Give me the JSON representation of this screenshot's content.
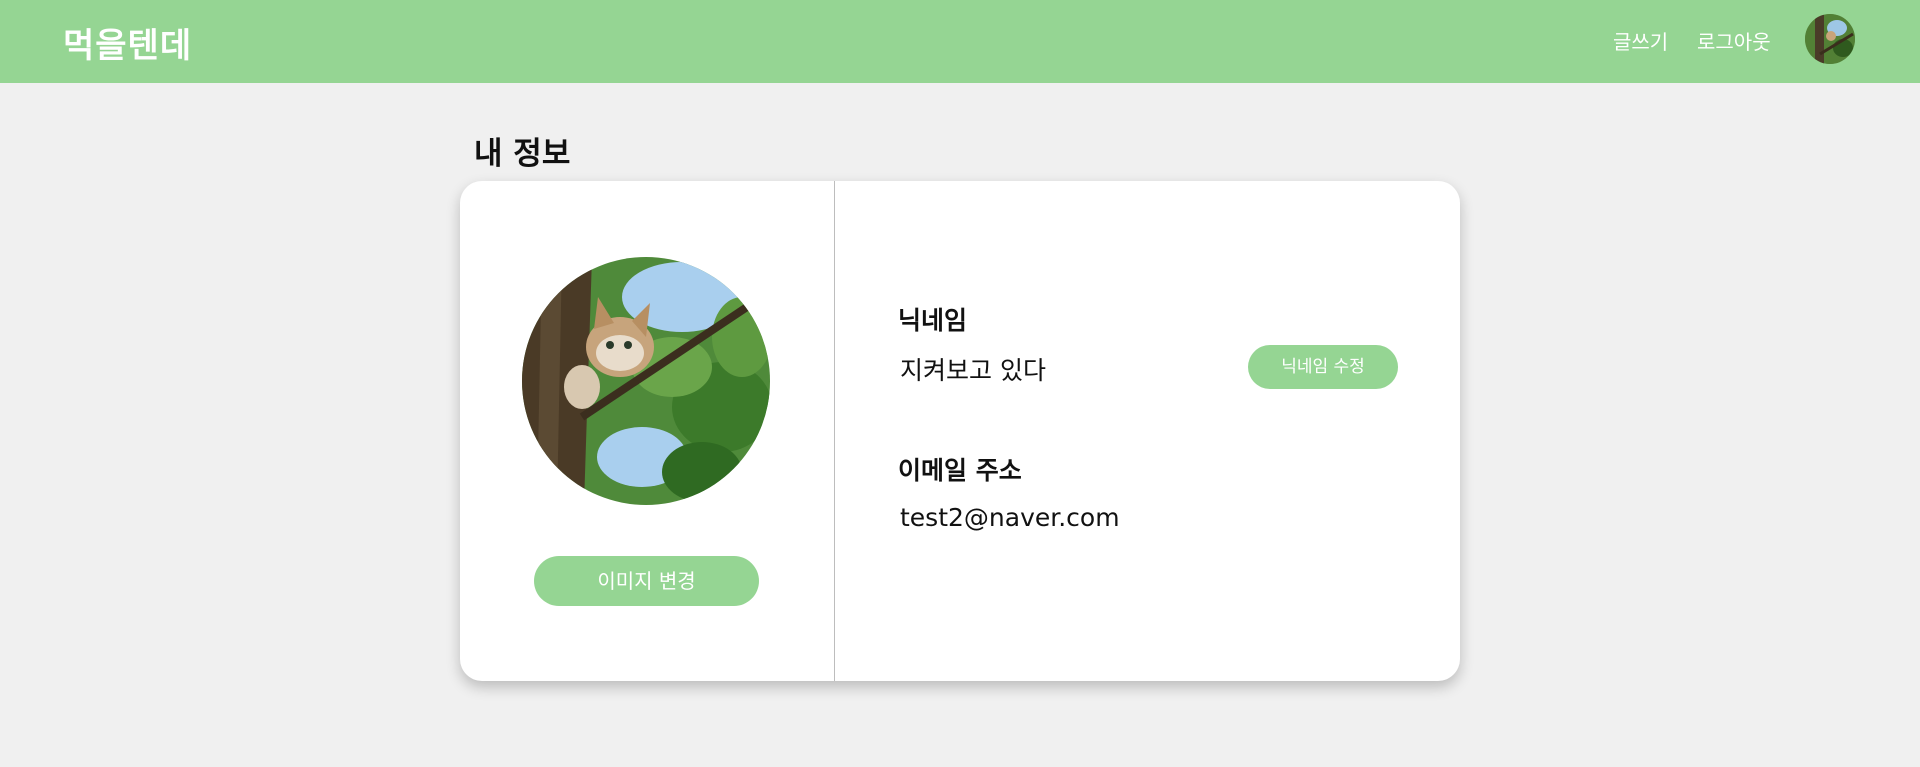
{
  "header": {
    "logo": "먹을텐데",
    "nav": {
      "write": "글쓰기",
      "logout": "로그아웃"
    },
    "avatar_icon": "user-avatar-cat-photo"
  },
  "page": {
    "title": "내 정보"
  },
  "profile": {
    "image_icon": "cat-in-tree-photo",
    "change_image_button": "이미지 변경"
  },
  "info": {
    "nickname_label": "닉네임",
    "nickname_value": "지켜보고 있다",
    "edit_nickname_button": "닉네임 수정",
    "email_label": "이메일 주소",
    "email_value": "test2@naver.com"
  },
  "colors": {
    "accent": "#95d593",
    "background": "#f0f0f0",
    "card": "#ffffff"
  }
}
